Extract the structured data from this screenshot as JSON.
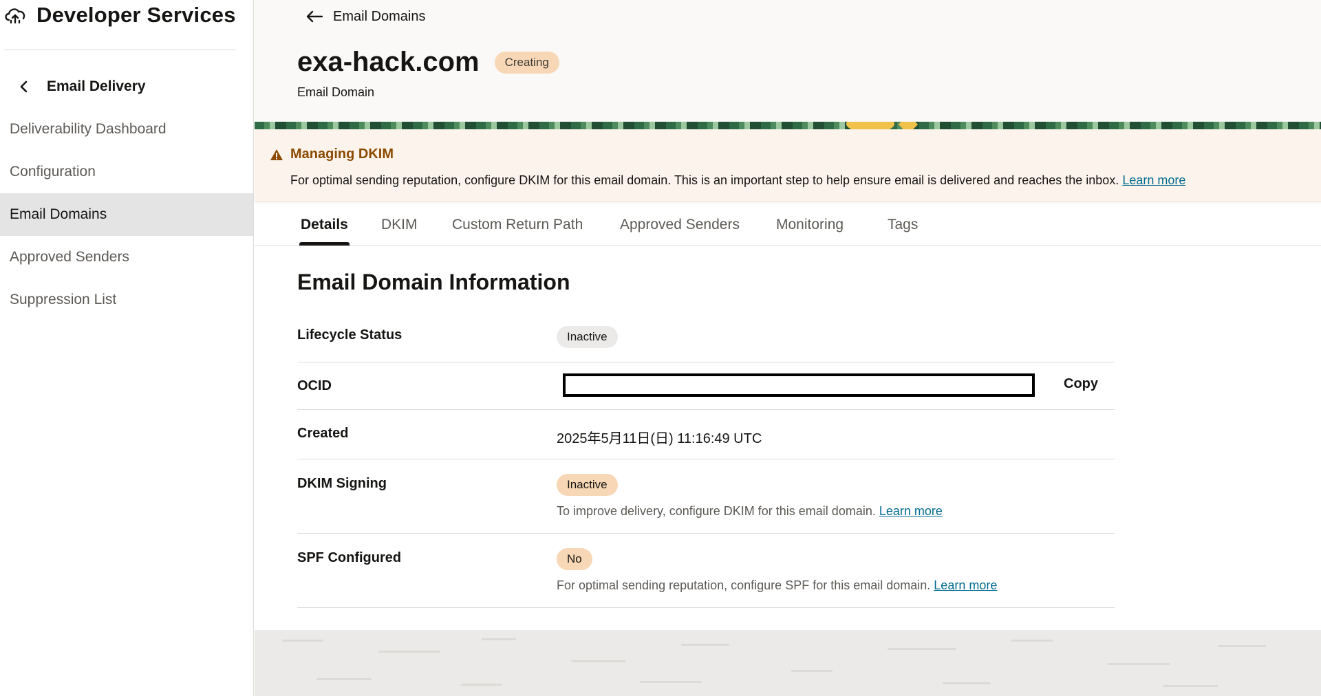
{
  "sidebar": {
    "brand_title": "Developer Services",
    "back_label": "Email Delivery",
    "items": [
      {
        "label": "Deliverability Dashboard"
      },
      {
        "label": "Configuration"
      },
      {
        "label": "Email Domains"
      },
      {
        "label": "Approved Senders"
      },
      {
        "label": "Suppression List"
      }
    ],
    "active_item": "Email Domains"
  },
  "header": {
    "back_label": "Email Domains",
    "title": "exa-hack.com",
    "status_badge": "Creating",
    "subtitle": "Email Domain"
  },
  "alert": {
    "title": "Managing DKIM",
    "body": "For optimal sending reputation, configure DKIM for this email domain. This is an important step to help ensure email is delivered and reaches the inbox.",
    "link": "Learn more"
  },
  "tabs": [
    {
      "label": "Details"
    },
    {
      "label": "DKIM"
    },
    {
      "label": "Custom Return Path"
    },
    {
      "label": "Approved Senders"
    },
    {
      "label": "Monitoring"
    },
    {
      "label": "Tags"
    }
  ],
  "active_tab": "Details",
  "details": {
    "section_title": "Email Domain Information",
    "lifecycle_status": {
      "label": "Lifecycle Status",
      "value": "Inactive"
    },
    "ocid": {
      "label": "OCID",
      "value": "",
      "copy_label": "Copy"
    },
    "created": {
      "label": "Created",
      "value": "2025年5月11日(日) 11:16:49 UTC"
    },
    "dkim_signing": {
      "label": "DKIM Signing",
      "value": "Inactive",
      "helper": "To improve delivery, configure DKIM for this email domain.",
      "link": "Learn more"
    },
    "spf_configured": {
      "label": "SPF Configured",
      "value": "No",
      "helper": "For optimal sending reputation, configure SPF for this email domain.",
      "link": "Learn more"
    }
  },
  "colors": {
    "accent_link": "#006b8f",
    "warning_title": "#8b4a00",
    "badge_orange": "#f7d7b5",
    "badge_grey": "#ebeae8",
    "active_nav_bg": "#e4e4e4"
  },
  "icons": {
    "brand": "cloud-upload-icon",
    "sidebar_back": "chevron-left-icon",
    "header_back": "arrow-left-icon",
    "alert": "warning-icon"
  }
}
